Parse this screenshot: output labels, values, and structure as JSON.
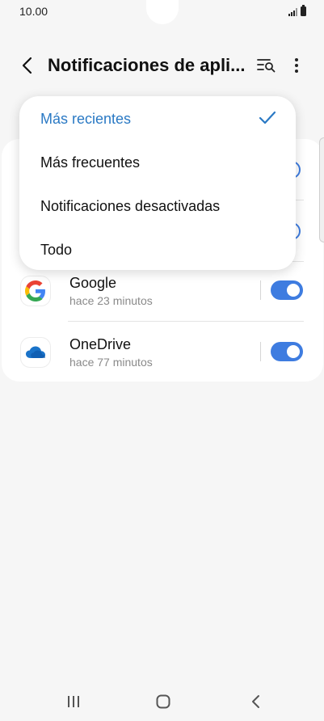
{
  "status_bar": {
    "time": "10.00"
  },
  "header": {
    "title": "Notificaciones de apli..."
  },
  "apps": [
    {
      "name": "Google",
      "time": "hace 23 minutos",
      "enabled": true
    },
    {
      "name": "OneDrive",
      "time": "hace 77 minutos",
      "enabled": true
    }
  ],
  "sort_menu": {
    "items": [
      {
        "label": "Más recientes",
        "selected": true
      },
      {
        "label": "Más frecuentes",
        "selected": false
      },
      {
        "label": "Notificaciones desactivadas",
        "selected": false
      },
      {
        "label": "Todo",
        "selected": false
      }
    ]
  },
  "colors": {
    "accent": "#3e7ce0",
    "selected_text": "#2a79c4",
    "background": "#f6f6f6"
  },
  "icons": {
    "back": "back-arrow-icon",
    "sort_search": "sort-search-icon",
    "more": "more-vert-icon",
    "check": "check-icon",
    "google": "google-logo-icon",
    "onedrive": "onedrive-cloud-icon"
  }
}
